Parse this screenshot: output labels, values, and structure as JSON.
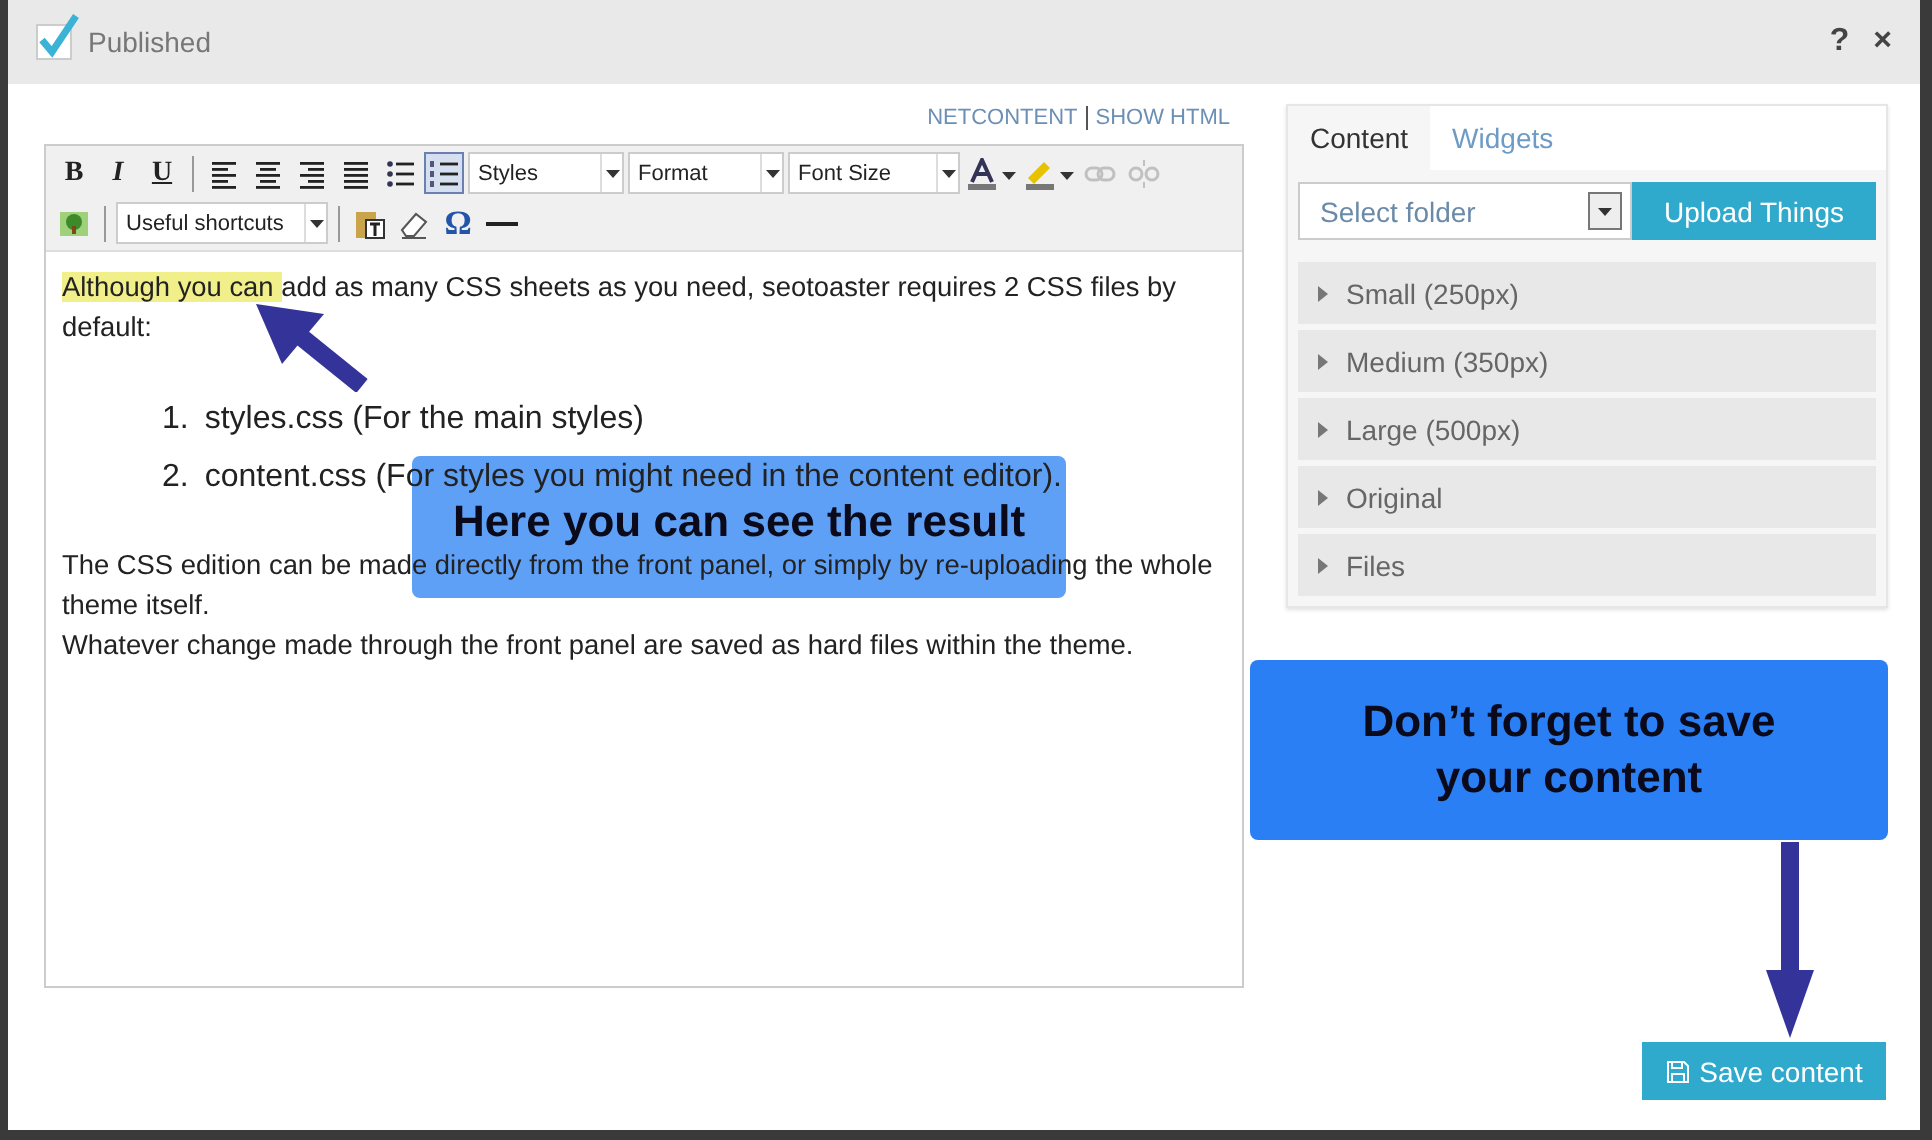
{
  "header": {
    "published": {
      "label": "Published",
      "checked": true
    },
    "help": "?",
    "close": "×"
  },
  "editor": {
    "links": [
      "NETCONTENT",
      "SHOW HTML"
    ],
    "toolbar": [
      [
        {
          "kind": "letter",
          "text": "B"
        },
        {
          "kind": "letter",
          "text": "I"
        },
        {
          "kind": "letter",
          "text": "U"
        },
        {
          "kind": "sep"
        },
        {
          "kind": "icon",
          "selected": false
        },
        {
          "kind": "icon",
          "selected": false
        },
        {
          "kind": "icon",
          "selected": false
        },
        {
          "kind": "icon",
          "selected": false
        },
        {
          "kind": "icon",
          "selected": false
        },
        {
          "kind": "icon",
          "selected": true
        },
        {
          "kind": "dropdown",
          "text": "Styles"
        },
        {
          "kind": "dropdown",
          "text": "Format"
        },
        {
          "kind": "dropdown",
          "text": "Font Size"
        },
        {
          "kind": "icon",
          "selected": false
        },
        {
          "kind": "icon",
          "selected": false
        },
        {
          "kind": "icon",
          "disabled": true
        },
        {
          "kind": "icon",
          "disabled": true
        }
      ],
      [
        {
          "kind": "icon",
          "selected": false
        },
        {
          "kind": "sep"
        },
        {
          "kind": "dropdown",
          "text": "Useful shortcuts"
        },
        {
          "kind": "sep"
        },
        {
          "kind": "icon",
          "selected": false
        },
        {
          "kind": "icon",
          "selected": false
        },
        {
          "kind": "letter",
          "text": "Ω"
        },
        {
          "kind": "icon",
          "selected": false
        }
      ]
    ],
    "content": [
      {
        "kind": "paragraph",
        "parts": [
          {
            "text": " Although you can ",
            "highlight": true
          },
          {
            "text": " add as many CSS sheets as you need, seotoaster requires 2 CSS files by default:",
            "highlight": false
          }
        ]
      },
      {
        "kind": "list",
        "items": [
          {
            "number": "1.",
            "text": "styles.css (For the main styles)"
          },
          {
            "number": "2.",
            "text": "content.css (For styles you might need in the content editor)."
          }
        ]
      },
      {
        "kind": "paragraph",
        "parts": [
          {
            "text": "The CSS edition can be made directly from the front panel, or simply by re-uploading the whole theme itself.",
            "highlight": false
          }
        ]
      },
      {
        "kind": "paragraph",
        "parts": [
          {
            "text": "Whatever change made through the front panel are saved as hard files within the theme.",
            "highlight": false
          }
        ]
      }
    ]
  },
  "side": {
    "tabs": [
      {
        "label": "Content",
        "selected": true
      },
      {
        "label": "Widgets",
        "selected": false
      }
    ],
    "folder": {
      "placeholder": "Select folder"
    },
    "upload": "Upload Things",
    "sections": [
      {
        "label": "Small (250px)",
        "expanded": false
      },
      {
        "label": "Medium (350px)",
        "expanded": false
      },
      {
        "label": "Large (500px)",
        "expanded": false
      },
      {
        "label": "Original",
        "expanded": false
      },
      {
        "label": "Files",
        "expanded": false
      }
    ]
  },
  "callouts": [
    {
      "text": "Here you can see the result"
    },
    {
      "text": "Don’t forget to save your content"
    }
  ],
  "save": "Save content"
}
